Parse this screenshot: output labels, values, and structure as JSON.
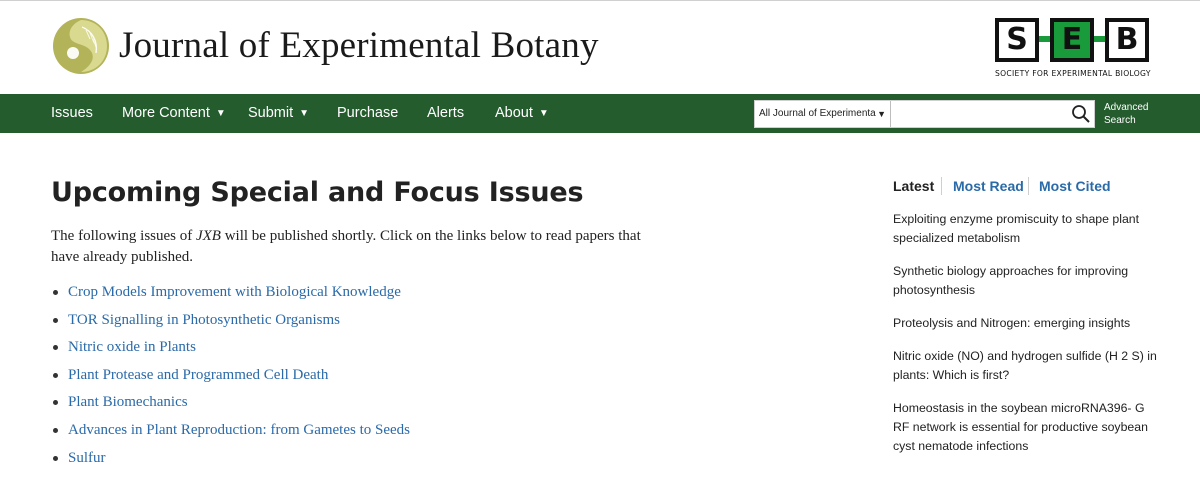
{
  "header": {
    "journal_title": "Journal of Experimental Botany",
    "seb_letters": [
      "S",
      "E",
      "B"
    ],
    "seb_subtitle": "SOCIETY FOR EXPERIMENTAL BIOLOGY"
  },
  "nav": {
    "items": [
      {
        "label": "Issues",
        "dropdown": false
      },
      {
        "label": "More Content",
        "dropdown": true
      },
      {
        "label": "Submit",
        "dropdown": true
      },
      {
        "label": "Purchase",
        "dropdown": false
      },
      {
        "label": "Alerts",
        "dropdown": false
      },
      {
        "label": "About",
        "dropdown": true
      }
    ],
    "caret": "▼"
  },
  "search": {
    "scope_selected": "All Journal of Experimenta",
    "caret": "▼",
    "placeholder": "",
    "button_icon": "search-icon",
    "advanced_line1": "Advanced",
    "advanced_line2": "Search"
  },
  "main": {
    "title": "Upcoming Special and Focus Issues",
    "intro_before": "The following issues of ",
    "intro_em": "JXB",
    "intro_after": " will be published shortly. Click on the links below to read papers that have already published.",
    "issues": [
      "Crop Models Improvement with Biological Knowledge",
      "TOR Signalling in Photosynthetic Organisms",
      "Nitric oxide in Plants",
      "Plant Protease and Programmed Cell Death",
      "Plant Biomechanics",
      "Advances in Plant Reproduction: from Gametes to Seeds",
      "Sulfur"
    ]
  },
  "sidebar": {
    "tabs": [
      "Latest",
      "Most Read",
      "Most Cited"
    ],
    "active_tab": "Latest",
    "latest": [
      "Exploiting enzyme promiscuity to shape plant specialized metabolism",
      "Synthetic biology approaches for improving photosynthesis",
      "Proteolysis and Nitrogen: emerging insights",
      "Nitric oxide (NO) and hydrogen sulfide (H 2 S) in plants: Which is first?",
      "Homeostasis in the soybean microRNA396- G RF network is essential for productive soybean cyst nematode infections"
    ]
  },
  "colors": {
    "nav_green": "#245c2e",
    "link_blue": "#2a6aa8",
    "seb_green": "#1a9b3b",
    "logo_olive": "#b3b35a"
  }
}
